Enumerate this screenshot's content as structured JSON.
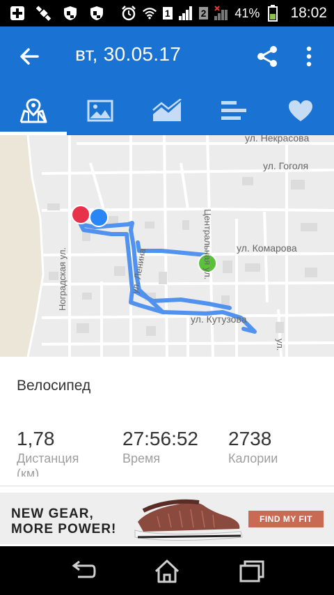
{
  "status_bar": {
    "sim1_label": "1",
    "sim2_label": "2",
    "battery_percent": "41%",
    "time": "18:02"
  },
  "app_bar": {
    "title": "вт, 30.05.17"
  },
  "tabs": [
    {
      "name": "map",
      "icon": "map-icon",
      "selected": true
    },
    {
      "name": "photos",
      "icon": "image-icon",
      "selected": false
    },
    {
      "name": "charts",
      "icon": "chart-icon",
      "selected": false
    },
    {
      "name": "splits",
      "icon": "bars-icon",
      "selected": false
    },
    {
      "name": "heart",
      "icon": "heart-icon",
      "selected": false
    }
  ],
  "map": {
    "streets": {
      "nekrasova": "ул. Некрасова",
      "gogolya": "ул. Гоголя",
      "komarova": "ул. Комарова",
      "tsentralnaya": "Центральная ул.",
      "lenina": "ул. Ленина",
      "kutuzova": "ул. Кутузова",
      "nogradskaya": "Ноградская ул.",
      "edge": "ул."
    },
    "colors": {
      "route": "#4a8ef0",
      "start_marker": "#5cc13a",
      "end_marker": "#e8324c",
      "position_marker": "#2a86f5"
    }
  },
  "activity": {
    "type": "Велосипед",
    "stats": [
      {
        "value": "1,78",
        "label": "Дистанция",
        "sublabel": "(км)"
      },
      {
        "value": "27:56:52",
        "label": "Время"
      },
      {
        "value": "2738",
        "label": "Калории"
      }
    ]
  },
  "ad": {
    "headline_line1": "NEW GEAR,",
    "headline_line2": "MORE POWER!",
    "button": "FIND MY FIT"
  },
  "colors": {
    "primary": "#1a73d3",
    "accent_button": "#c96a55"
  }
}
